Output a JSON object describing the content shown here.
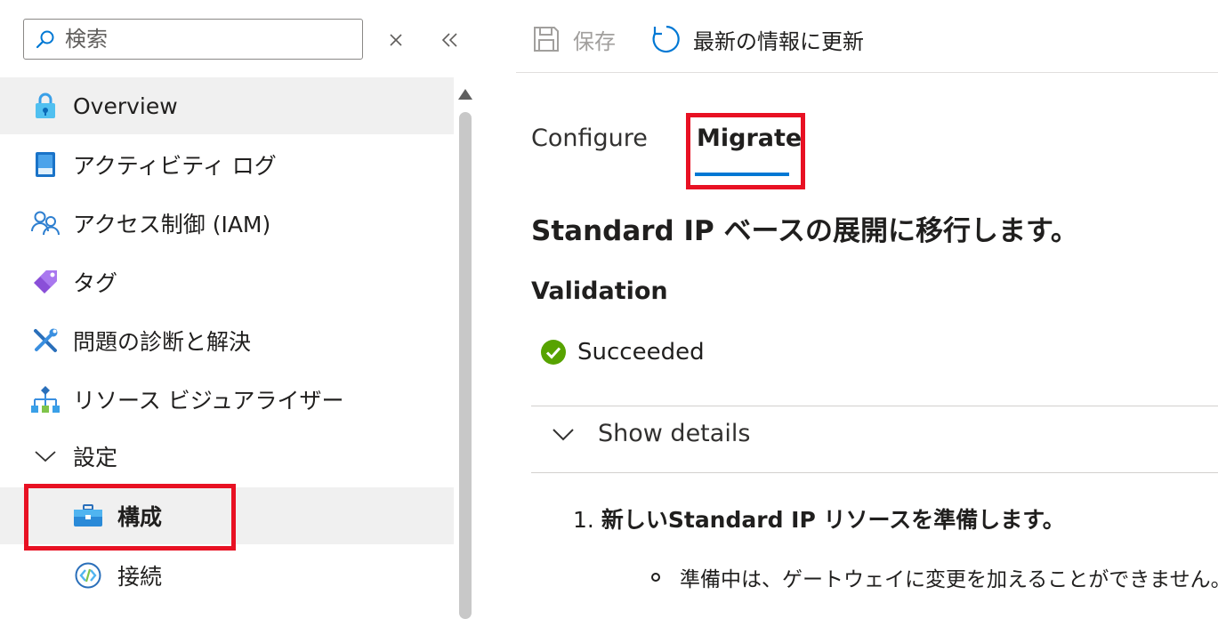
{
  "sidebar": {
    "search": {
      "placeholder": "検索",
      "value": ""
    },
    "items": [
      {
        "label": "Overview",
        "icon": "lock-shield-icon"
      },
      {
        "label": "アクティビティ ログ",
        "icon": "activity-log-icon"
      },
      {
        "label": "アクセス制御 (IAM)",
        "icon": "people-icon"
      },
      {
        "label": "タグ",
        "icon": "tag-icon"
      },
      {
        "label": "問題の診断と解決",
        "icon": "wrench-icon"
      },
      {
        "label": "リソース ビジュアライザー",
        "icon": "visualizer-icon"
      },
      {
        "label": "設定",
        "icon": "chevron-down-icon"
      },
      {
        "label": "構成",
        "icon": "toolbox-icon"
      },
      {
        "label": "接続",
        "icon": "connection-icon"
      }
    ]
  },
  "toolbar": {
    "save_label": "保存",
    "refresh_label": "最新の情報に更新"
  },
  "tabs": [
    {
      "label": "Configure"
    },
    {
      "label": "Migrate"
    }
  ],
  "content": {
    "heading": "Standard IP ベースの展開に移行します。",
    "validation_title": "Validation",
    "validation_status": "Succeeded",
    "show_details": "Show details",
    "step_number": "1.",
    "step_text": "新しいStandard IP リソースを準備します。",
    "bullet_text": "準備中は、ゲートウェイに変更を加えることができません。"
  },
  "colors": {
    "accent": "#0078d4",
    "highlight": "#e81123",
    "success": "#57a300",
    "selected_bg": "#f0f0f0"
  }
}
